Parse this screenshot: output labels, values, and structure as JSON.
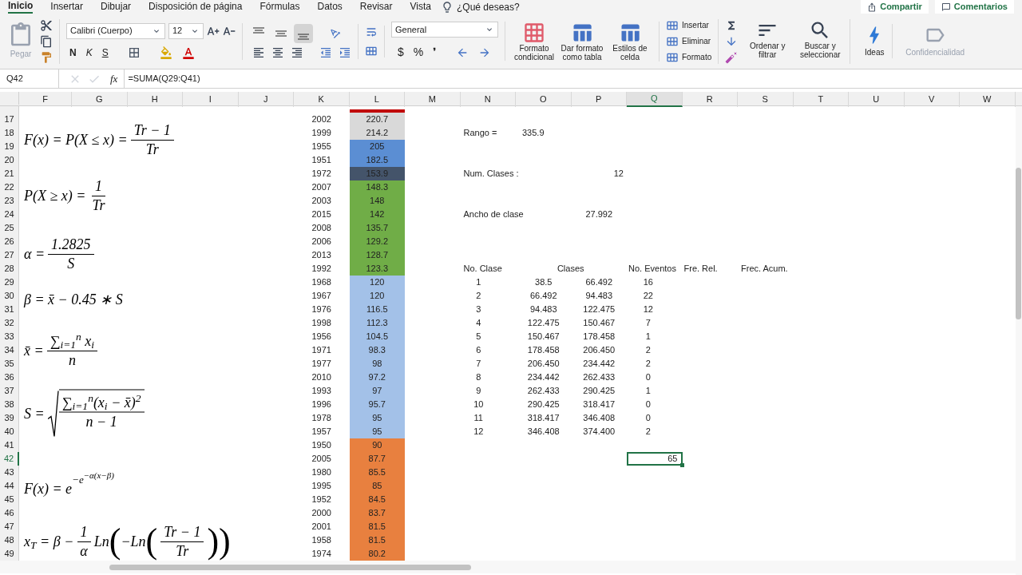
{
  "ribbon_tabs": [
    {
      "label": "Inicio",
      "selected": true
    },
    {
      "label": "Insertar",
      "selected": false
    },
    {
      "label": "Dibujar",
      "selected": false
    },
    {
      "label": "Disposición de página",
      "selected": false
    },
    {
      "label": "Fórmulas",
      "selected": false
    },
    {
      "label": "Datos",
      "selected": false
    },
    {
      "label": "Revisar",
      "selected": false
    },
    {
      "label": "Vista",
      "selected": false
    }
  ],
  "search": "¿Qué deseas?",
  "share_button": "Compartir",
  "comments_button": "Comentarios",
  "clipboard": {
    "paste": "Pegar",
    "paste_disabled": true
  },
  "font": {
    "name": "Calibri (Cuerpo)",
    "size": "12",
    "styles": [
      "N",
      "K",
      "S"
    ]
  },
  "alignment": [
    {
      "kind": "top",
      "selected": false
    },
    {
      "kind": "middle",
      "selected": false
    },
    {
      "kind": "bottom",
      "selected": true
    }
  ],
  "number_format": {
    "value": "General",
    "symbols": [
      "$",
      "%",
      "❜"
    ]
  },
  "style_buttons": [
    "Formato condicional",
    "Dar formato como tabla",
    "Estilos de celda"
  ],
  "cell_buttons": [
    "Insertar",
    "Eliminar",
    "Formato"
  ],
  "edit_buttons": [
    "Ordenar y filtrar",
    "Buscar y seleccionar"
  ],
  "ideas": "Ideas",
  "sensitivity": {
    "label": "Confidencialidad",
    "disabled": true
  },
  "formula_bar": {
    "name_box": "Q42",
    "fx": "fx",
    "formula": "=SUMA(Q29:Q41)"
  },
  "columns": [
    {
      "label": "F",
      "selected": false
    },
    {
      "label": "G",
      "selected": false
    },
    {
      "label": "H",
      "selected": false
    },
    {
      "label": "I",
      "selected": false
    },
    {
      "label": "J",
      "selected": false
    },
    {
      "label": "K",
      "selected": false
    },
    {
      "label": "L",
      "selected": false
    },
    {
      "label": "M",
      "selected": false
    },
    {
      "label": "N",
      "selected": false
    },
    {
      "label": "O",
      "selected": false
    },
    {
      "label": "P",
      "selected": false
    },
    {
      "label": "Q",
      "selected": true
    },
    {
      "label": "R",
      "selected": false
    },
    {
      "label": "S",
      "selected": false
    },
    {
      "label": "T",
      "selected": false
    },
    {
      "label": "U",
      "selected": false
    },
    {
      "label": "V",
      "selected": false
    },
    {
      "label": "W",
      "selected": false
    }
  ],
  "cut_row": {
    "color": "#c00000"
  },
  "rows": [
    {
      "number": "17",
      "selected": false,
      "year": "2002",
      "value": "220.7",
      "color": "#d9d9d9"
    },
    {
      "number": "18",
      "selected": false,
      "year": "1999",
      "value": "214.2",
      "color": "#d9d9d9"
    },
    {
      "number": "19",
      "selected": false,
      "year": "1955",
      "value": "205",
      "color": "#5b8ed3"
    },
    {
      "number": "20",
      "selected": false,
      "year": "1951",
      "value": "182.5",
      "color": "#5b8ed3"
    },
    {
      "number": "21",
      "selected": false,
      "year": "1972",
      "value": "153.9",
      "color": "#44546a"
    },
    {
      "number": "22",
      "selected": false,
      "year": "2007",
      "value": "148.3",
      "color": "#70ad47"
    },
    {
      "number": "23",
      "selected": false,
      "year": "2003",
      "value": "148",
      "color": "#70ad47"
    },
    {
      "number": "24",
      "selected": false,
      "year": "2015",
      "value": "142",
      "color": "#70ad47"
    },
    {
      "number": "25",
      "selected": false,
      "year": "2008",
      "value": "135.7",
      "color": "#70ad47"
    },
    {
      "number": "26",
      "selected": false,
      "year": "2006",
      "value": "129.2",
      "color": "#70ad47"
    },
    {
      "number": "27",
      "selected": false,
      "year": "2013",
      "value": "128.7",
      "color": "#70ad47"
    },
    {
      "number": "28",
      "selected": false,
      "year": "1992",
      "value": "123.3",
      "color": "#70ad47"
    },
    {
      "number": "29",
      "selected": false,
      "year": "1968",
      "value": "120",
      "color": "#a3c1e8"
    },
    {
      "number": "30",
      "selected": false,
      "year": "1967",
      "value": "120",
      "color": "#a3c1e8"
    },
    {
      "number": "31",
      "selected": false,
      "year": "1976",
      "value": "116.5",
      "color": "#a3c1e8"
    },
    {
      "number": "32",
      "selected": false,
      "year": "1998",
      "value": "112.3",
      "color": "#a3c1e8"
    },
    {
      "number": "33",
      "selected": false,
      "year": "1956",
      "value": "104.5",
      "color": "#a3c1e8"
    },
    {
      "number": "34",
      "selected": false,
      "year": "1971",
      "value": "98.3",
      "color": "#a3c1e8"
    },
    {
      "number": "35",
      "selected": false,
      "year": "1977",
      "value": "98",
      "color": "#a3c1e8"
    },
    {
      "number": "36",
      "selected": false,
      "year": "2010",
      "value": "97.2",
      "color": "#a3c1e8"
    },
    {
      "number": "37",
      "selected": false,
      "year": "1993",
      "value": "97",
      "color": "#a3c1e8"
    },
    {
      "number": "38",
      "selected": false,
      "year": "1996",
      "value": "95.7",
      "color": "#a3c1e8"
    },
    {
      "number": "39",
      "selected": false,
      "year": "1978",
      "value": "95",
      "color": "#a3c1e8"
    },
    {
      "number": "40",
      "selected": false,
      "year": "1957",
      "value": "95",
      "color": "#a3c1e8"
    },
    {
      "number": "41",
      "selected": false,
      "year": "1950",
      "value": "90",
      "color": "#e8803f"
    },
    {
      "number": "42",
      "selected": true,
      "year": "2005",
      "value": "87.7",
      "color": "#e8803f"
    },
    {
      "number": "43",
      "selected": false,
      "year": "1980",
      "value": "85.5",
      "color": "#e8803f"
    },
    {
      "number": "44",
      "selected": false,
      "year": "1995",
      "value": "85",
      "color": "#e8803f"
    },
    {
      "number": "45",
      "selected": false,
      "year": "1952",
      "value": "84.5",
      "color": "#e8803f"
    },
    {
      "number": "46",
      "selected": false,
      "year": "2000",
      "value": "83.7",
      "color": "#e8803f"
    },
    {
      "number": "47",
      "selected": false,
      "year": "2001",
      "value": "81.5",
      "color": "#e8803f"
    },
    {
      "number": "48",
      "selected": false,
      "year": "1958",
      "value": "81.5",
      "color": "#e8803f"
    },
    {
      "number": "49",
      "selected": false,
      "year": "1974",
      "value": "80.2",
      "color": "#e8803f"
    }
  ],
  "stats": [
    {
      "label": "Rango =",
      "value": "335.9"
    },
    {
      "label": "Num. Clases :",
      "value": "12"
    },
    {
      "label": "Ancho de clase",
      "value": "27.992"
    }
  ],
  "class_table": {
    "columns": [
      "No. Clase",
      "Clases",
      "No. Eventos",
      "Fre. Rel.",
      "Frec. Acum."
    ],
    "rows": [
      {
        "class": "1",
        "from": "38.5",
        "to": "66.492",
        "events": "16"
      },
      {
        "class": "2",
        "from": "66.492",
        "to": "94.483",
        "events": "22"
      },
      {
        "class": "3",
        "from": "94.483",
        "to": "122.475",
        "events": "12"
      },
      {
        "class": "4",
        "from": "122.475",
        "to": "150.467",
        "events": "7"
      },
      {
        "class": "5",
        "from": "150.467",
        "to": "178.458",
        "events": "1"
      },
      {
        "class": "6",
        "from": "178.458",
        "to": "206.450",
        "events": "2"
      },
      {
        "class": "7",
        "from": "206.450",
        "to": "234.442",
        "events": "2"
      },
      {
        "class": "8",
        "from": "234.442",
        "to": "262.433",
        "events": "0"
      },
      {
        "class": "9",
        "from": "262.433",
        "to": "290.425",
        "events": "1"
      },
      {
        "class": "10",
        "from": "290.425",
        "to": "318.417",
        "events": "0"
      },
      {
        "class": "11",
        "from": "318.417",
        "to": "346.408",
        "events": "0"
      },
      {
        "class": "12",
        "from": "346.408",
        "to": "374.400",
        "events": "2"
      }
    ],
    "total": "65"
  },
  "formulas": [
    {
      "parts": [
        {
          "kind": "text",
          "text": "F(x) = P(X ≤ x) ="
        },
        {
          "kind": "frac",
          "num": "Tr − 1",
          "den": "Tr"
        }
      ]
    },
    {
      "parts": [
        {
          "kind": "text",
          "text": "P(X ≥ x) ="
        },
        {
          "kind": "frac",
          "num": "1",
          "den": "Tr"
        }
      ]
    },
    {
      "parts": [
        {
          "kind": "text",
          "text": "α ="
        },
        {
          "kind": "frac",
          "num": "1.2825",
          "den": "S"
        }
      ]
    },
    {
      "parts": [
        {
          "kind": "text",
          "text": "β = x̄ − 0.45 ∗ S"
        }
      ]
    },
    {
      "parts": [
        {
          "kind": "text",
          "text": "x̄ ="
        },
        {
          "kind": "frac",
          "num": "∑$_{i=1}$$^{n}$ x$_{i}$",
          "den": "n"
        }
      ]
    },
    {
      "parts": [
        {
          "kind": "text",
          "text": "S ="
        },
        {
          "kind": "sqrt",
          "num": "∑$_{i=1}$$^{n}$(x$_{i}$ − x̄)$^{2}$",
          "den": "n − 1"
        }
      ]
    },
    {
      "parts": [
        {
          "kind": "power",
          "base": "F(x) = e",
          "exp": "−e",
          "exp2": "−α(x−β)"
        }
      ]
    },
    {
      "parts": [
        {
          "kind": "text",
          "text": "x$_{T}$ = β −"
        },
        {
          "kind": "frac",
          "num": "1",
          "den": "α"
        },
        {
          "kind": "text",
          "text": "Ln"
        },
        {
          "kind": "paren",
          "text": "("
        },
        {
          "kind": "text",
          "text": "−Ln"
        },
        {
          "kind": "paren",
          "text": "("
        },
        {
          "kind": "frac",
          "num": "Tr − 1",
          "den": "Tr"
        },
        {
          "kind": "paren",
          "text": ")"
        },
        {
          "kind": "paren",
          "text": ")"
        }
      ]
    }
  ]
}
